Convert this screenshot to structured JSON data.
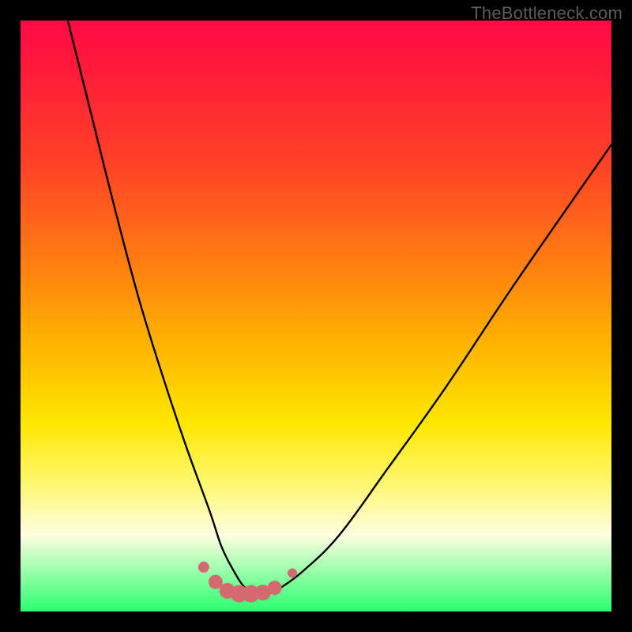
{
  "watermark": "TheBottleneck.com",
  "colors": {
    "page_bg": "#000000",
    "curve_stroke": "#000000",
    "marker_fill": "#d46a6f",
    "green_band": "#2bff6f"
  },
  "chart_data": {
    "type": "line",
    "title": "",
    "xlabel": "",
    "ylabel": "",
    "xlim": [
      0,
      100
    ],
    "ylim": [
      0,
      100
    ],
    "grid": false,
    "legend": false,
    "series": [
      {
        "name": "bottleneck-curve",
        "x": [
          8,
          12,
          16,
          20,
          24,
          28,
          32,
          34,
          36,
          38,
          40,
          42,
          44,
          48,
          54,
          62,
          72,
          84,
          100
        ],
        "y": [
          100,
          84,
          68,
          53,
          40,
          28,
          17,
          11,
          7,
          4,
          3,
          3,
          4,
          7,
          13,
          24,
          38,
          56,
          79
        ]
      }
    ],
    "markers": {
      "name": "bottom-dots",
      "x": [
        31,
        33,
        35,
        37,
        39,
        41,
        43,
        46
      ],
      "y": [
        7.5,
        5,
        3.5,
        3,
        3,
        3.2,
        4,
        6.5
      ],
      "size": [
        7,
        9,
        10,
        11,
        11,
        10,
        9,
        6
      ]
    }
  }
}
